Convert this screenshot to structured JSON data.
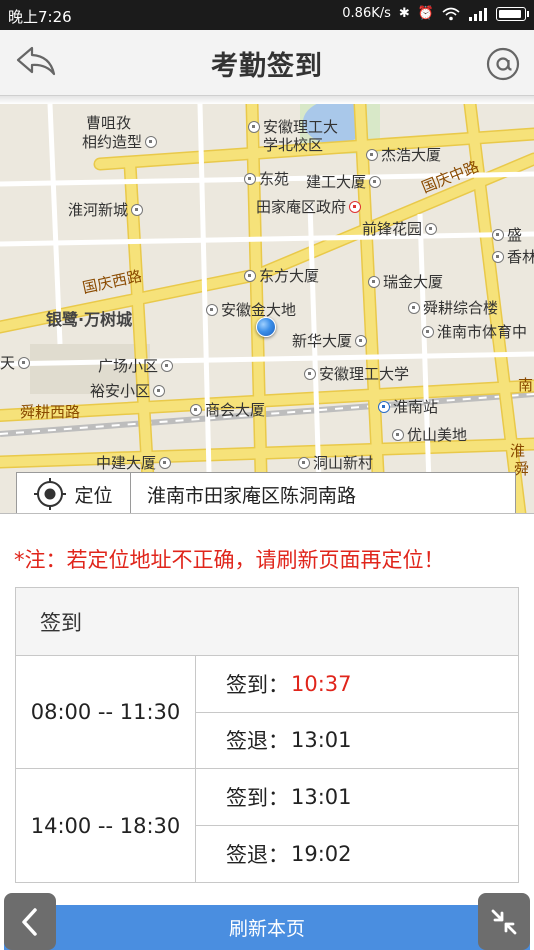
{
  "status_bar": {
    "time": "晚上7:26",
    "speed": "0.86K/s"
  },
  "header": {
    "title": "考勤签到"
  },
  "map": {
    "labels": [
      {
        "text": "曹咀孜",
        "icon": "none"
      },
      {
        "text": "相约造型",
        "icon": "poi"
      },
      {
        "text": "安徽理工大",
        "icon": "poi"
      },
      {
        "text": "学北校区",
        "icon": "none"
      },
      {
        "text": "杰浩大厦",
        "icon": "poi"
      },
      {
        "text": "东苑",
        "icon": "poi"
      },
      {
        "text": "建工大厦",
        "icon": "poi"
      },
      {
        "text": "淮河新城",
        "icon": "poi"
      },
      {
        "text": "田家庵区政府",
        "icon": "gov"
      },
      {
        "text": "国庆中路",
        "icon": "road"
      },
      {
        "text": "前锋花园",
        "icon": "poi"
      },
      {
        "text": "盛",
        "icon": "poi"
      },
      {
        "text": "香林",
        "icon": "poi"
      },
      {
        "text": "东方大厦",
        "icon": "poi"
      },
      {
        "text": "瑞金大厦",
        "icon": "poi"
      },
      {
        "text": "国庆西路",
        "icon": "road"
      },
      {
        "text": "银鹭·万树城",
        "icon": "big"
      },
      {
        "text": "安徽金大地",
        "icon": "poi"
      },
      {
        "text": "舜耕综合楼",
        "icon": "poi"
      },
      {
        "text": "新华大厦",
        "icon": "poi"
      },
      {
        "text": "淮南市体育中",
        "icon": "poi"
      },
      {
        "text": "天",
        "icon": "poi"
      },
      {
        "text": "广场小区",
        "icon": "poi"
      },
      {
        "text": "安徽理工大学",
        "icon": "poi"
      },
      {
        "text": "裕安小区",
        "icon": "poi"
      },
      {
        "text": "舜耕西路",
        "icon": "road"
      },
      {
        "text": "商会大厦",
        "icon": "poi"
      },
      {
        "text": "淮南站",
        "icon": "station"
      },
      {
        "text": "优山美地",
        "icon": "poi"
      },
      {
        "text": "中建大厦",
        "icon": "poi"
      },
      {
        "text": "洞山新村",
        "icon": "poi"
      },
      {
        "text": "淮",
        "icon": "road"
      },
      {
        "text": "舜",
        "icon": "road"
      },
      {
        "text": "南",
        "icon": "road"
      }
    ],
    "locate_label": "定位",
    "address": "淮南市田家庵区陈洞南路"
  },
  "note": "*注：若定位地址不正确，请刷新页面再定位！",
  "attendance": {
    "title": "签到",
    "shifts": [
      {
        "period": "08:00 -- 11:30",
        "checkin_label": "签到：",
        "checkin_time": "10:37",
        "checkin_late": true,
        "checkout_label": "签退：",
        "checkout_time": "13:01"
      },
      {
        "period": "14:00 -- 18:30",
        "checkin_label": "签到：",
        "checkin_time": "13:01",
        "checkin_late": false,
        "checkout_label": "签退：",
        "checkout_time": "19:02"
      }
    ]
  },
  "bottom_bar": {
    "refresh_label": "刷新本页"
  },
  "colors": {
    "accent_blue": "#4a8ee0",
    "warning_red": "#e0251b",
    "road_yellow": "#f6e27a"
  }
}
